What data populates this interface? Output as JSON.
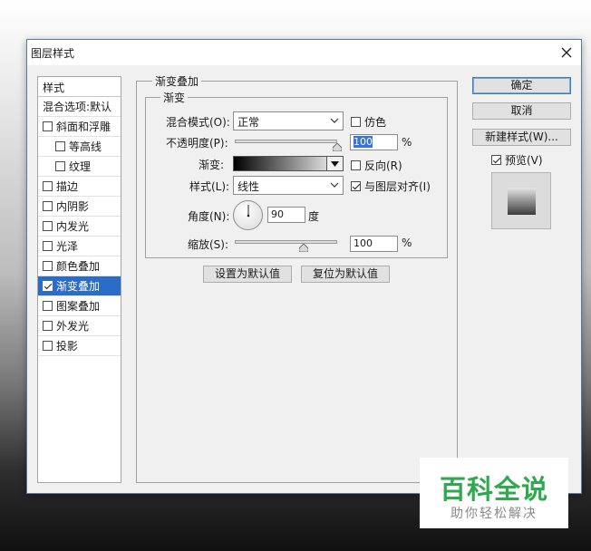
{
  "window": {
    "title": "图层样式"
  },
  "styles_list": {
    "header": "样式",
    "blend_options": "混合选项:默认",
    "items": [
      {
        "label": "斜面和浮雕",
        "checked": false,
        "indent": false,
        "selected": false
      },
      {
        "label": "等高线",
        "checked": false,
        "indent": true,
        "selected": false
      },
      {
        "label": "纹理",
        "checked": false,
        "indent": true,
        "selected": false
      },
      {
        "label": "描边",
        "checked": false,
        "indent": false,
        "selected": false
      },
      {
        "label": "内阴影",
        "checked": false,
        "indent": false,
        "selected": false
      },
      {
        "label": "内发光",
        "checked": false,
        "indent": false,
        "selected": false
      },
      {
        "label": "光泽",
        "checked": false,
        "indent": false,
        "selected": false
      },
      {
        "label": "颜色叠加",
        "checked": false,
        "indent": false,
        "selected": false
      },
      {
        "label": "渐变叠加",
        "checked": true,
        "indent": false,
        "selected": true
      },
      {
        "label": "图案叠加",
        "checked": false,
        "indent": false,
        "selected": false
      },
      {
        "label": "外发光",
        "checked": false,
        "indent": false,
        "selected": false
      },
      {
        "label": "投影",
        "checked": false,
        "indent": false,
        "selected": false
      }
    ]
  },
  "panel": {
    "group_title": "渐变叠加",
    "subgroup_title": "渐变",
    "blend_mode_label": "混合模式(O):",
    "blend_mode_value": "正常",
    "dither_label": "仿色",
    "dither_checked": false,
    "opacity_label": "不透明度(P):",
    "opacity_value": "100",
    "opacity_unit": "%",
    "opacity_level": 1.0,
    "gradient_label": "渐变:",
    "reverse_label": "反向(R)",
    "reverse_checked": false,
    "style_label": "样式(L):",
    "style_value": "线性",
    "align_label": "与图层对齐(I)",
    "align_checked": true,
    "angle_label": "角度(N):",
    "angle_value": "90",
    "angle_unit": "度",
    "scale_label": "缩放(S):",
    "scale_value": "100",
    "scale_unit": "%",
    "scale_level": 0.67,
    "set_default_label": "设置为默认值",
    "reset_default_label": "复位为默认值"
  },
  "buttons": {
    "ok": "确定",
    "cancel": "取消",
    "new_style": "新建样式(W)...",
    "preview_label": "预览(V)",
    "preview_checked": true
  },
  "watermark": {
    "title": "百科全说",
    "subtitle": "助你轻松解决"
  },
  "colors": {
    "accent": "#2b6cc8",
    "watermark_green": "#2fa84f"
  }
}
